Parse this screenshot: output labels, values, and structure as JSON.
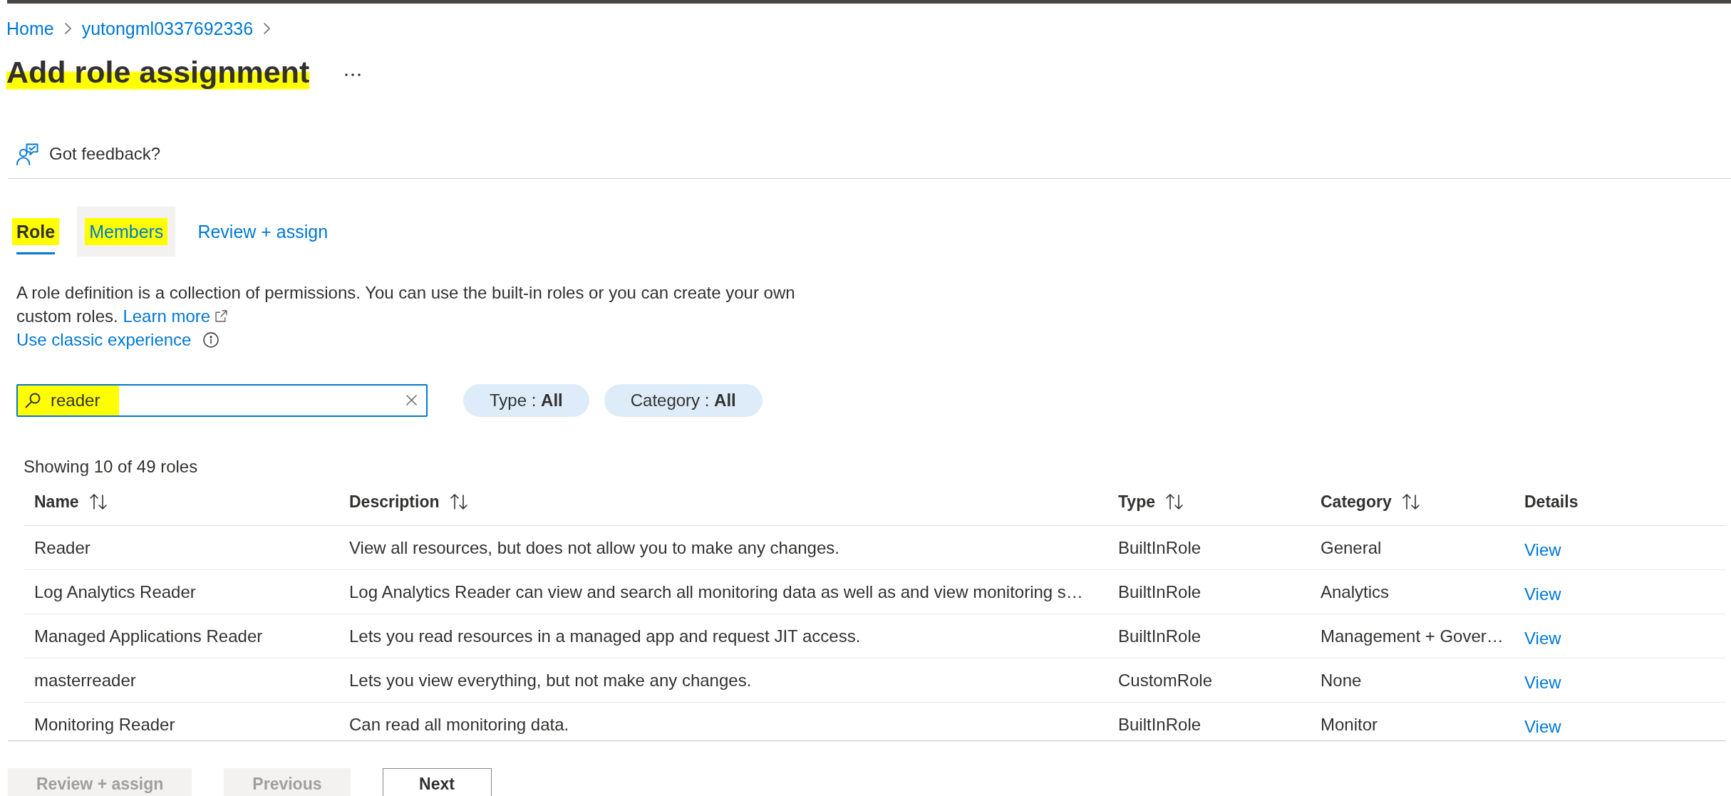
{
  "breadcrumb": [
    {
      "label": "Home"
    },
    {
      "label": "yutongml0337692336"
    }
  ],
  "page": {
    "title": "Add role assignment",
    "highlighted": true
  },
  "feedback": {
    "label": "Got feedback?"
  },
  "tabs": [
    {
      "label": "Role",
      "selected": true,
      "hovered": false,
      "highlighted": true
    },
    {
      "label": "Members",
      "selected": false,
      "hovered": true,
      "highlighted": true
    },
    {
      "label": "Review + assign",
      "selected": false,
      "hovered": false,
      "highlighted": false
    }
  ],
  "intro": {
    "text": "A role definition is a collection of permissions. You can use the built-in roles or you can create your own custom roles.",
    "learn_more": "Learn more",
    "classic_link": "Use classic experience"
  },
  "search": {
    "value": "reader",
    "highlighted": true
  },
  "filters": [
    {
      "text": "Type : **All**"
    },
    {
      "text": "Category : **All**"
    }
  ],
  "results_count": "Showing 10 of 49 roles",
  "table": {
    "columns": [
      {
        "label": "Name",
        "sortable": true
      },
      {
        "label": "Description",
        "sortable": true
      },
      {
        "label": "Type",
        "sortable": true
      },
      {
        "label": "Category",
        "sortable": true
      },
      {
        "label": "Details",
        "sortable": false
      }
    ],
    "rows": [
      {
        "name": "Reader",
        "description": "View all resources, but does not allow you to make any changes.",
        "type": "BuiltInRole",
        "category": "General",
        "details": "View"
      },
      {
        "name": "Log Analytics Reader",
        "description": "Log Analytics Reader can view and search all monitoring data as well as and view monitoring s…",
        "type": "BuiltInRole",
        "category": "Analytics",
        "details": "View"
      },
      {
        "name": "Managed Applications Reader",
        "description": "Lets you read resources in a managed app and request JIT access.",
        "type": "BuiltInRole",
        "category": "Management + Gover…",
        "details": "View"
      },
      {
        "name": "masterreader",
        "description": "Lets you view everything, but not make any changes.",
        "type": "CustomRole",
        "category": "None",
        "details": "View"
      },
      {
        "name": "Monitoring Reader",
        "description": "Can read all monitoring data.",
        "type": "BuiltInRole",
        "category": "Monitor",
        "details": "View"
      }
    ]
  },
  "buttons": [
    {
      "label": "Review + assign",
      "disabled": true
    },
    {
      "label": "Previous",
      "disabled": true
    },
    {
      "label": "Next",
      "disabled": false
    }
  ]
}
